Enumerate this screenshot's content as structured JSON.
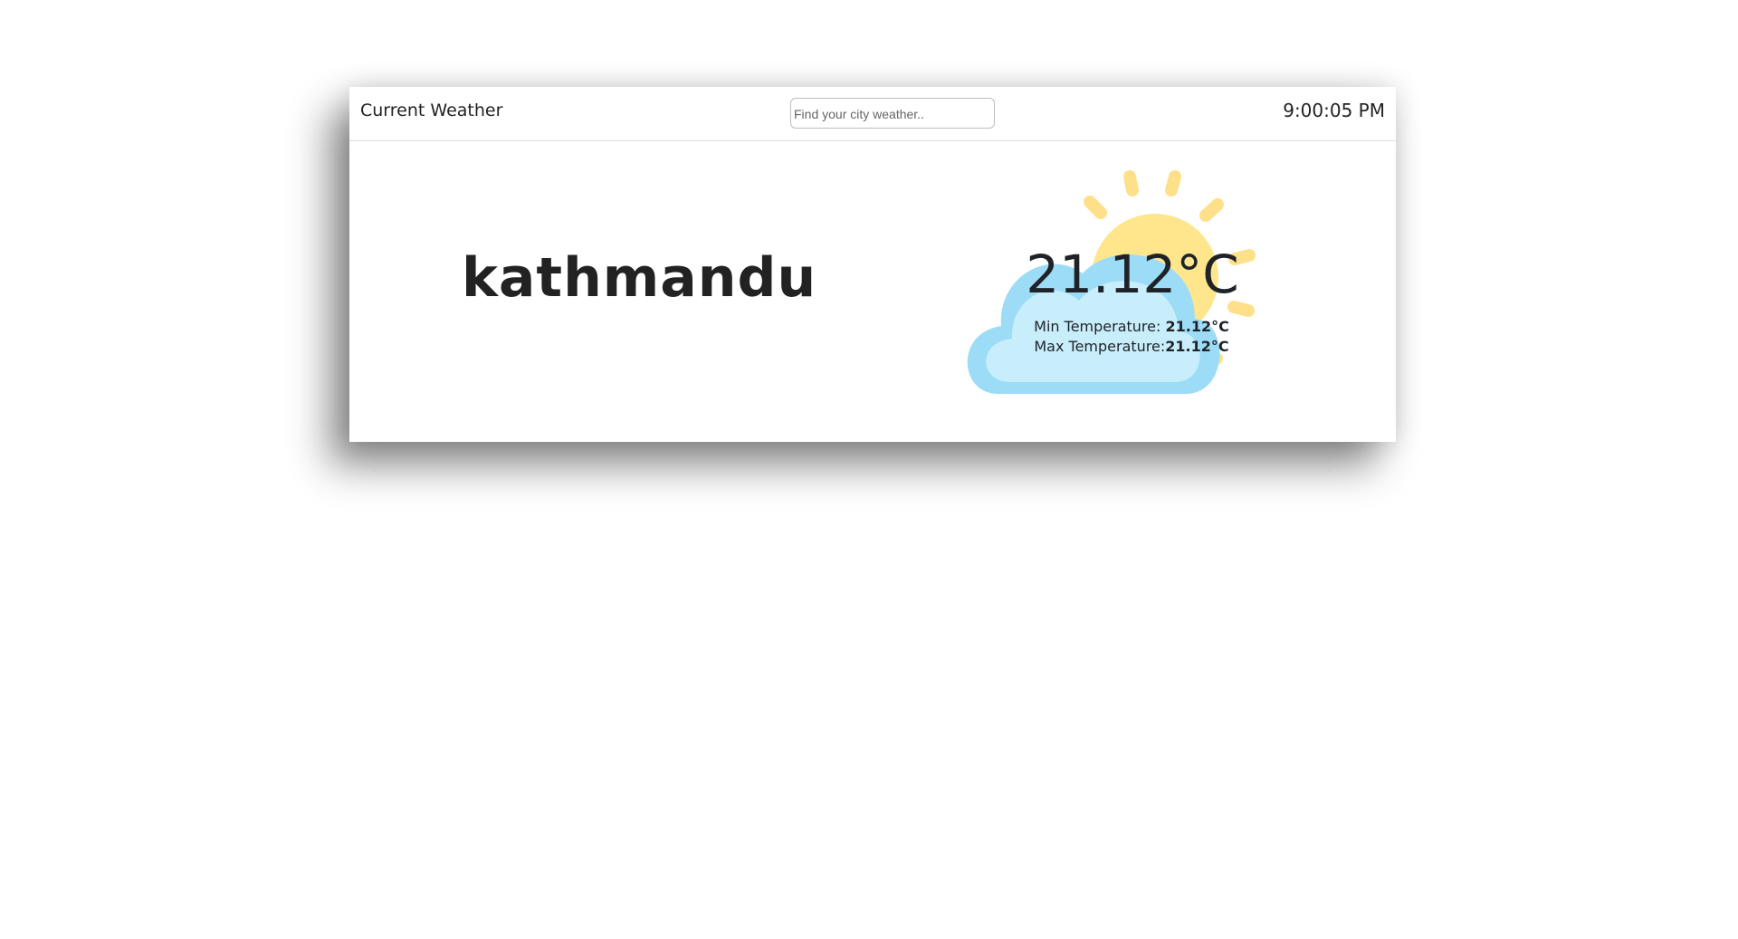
{
  "header": {
    "title": "Current Weather",
    "search_placeholder": "Find your city weather..",
    "search_value": "",
    "time": "9:00:05 PM"
  },
  "weather": {
    "city": "kathmandu",
    "temperature": "21.12°C",
    "min_label": "Min Temperature:",
    "min_value": "21.12°C",
    "max_label": "Max Temperature:",
    "max_value": "21.12°C",
    "icon": "partly-cloudy-icon"
  },
  "colors": {
    "sun": "#ffe68c",
    "cloud_outer": "#9cdcf6",
    "cloud_inner": "#c8eefb",
    "text": "#222222"
  }
}
